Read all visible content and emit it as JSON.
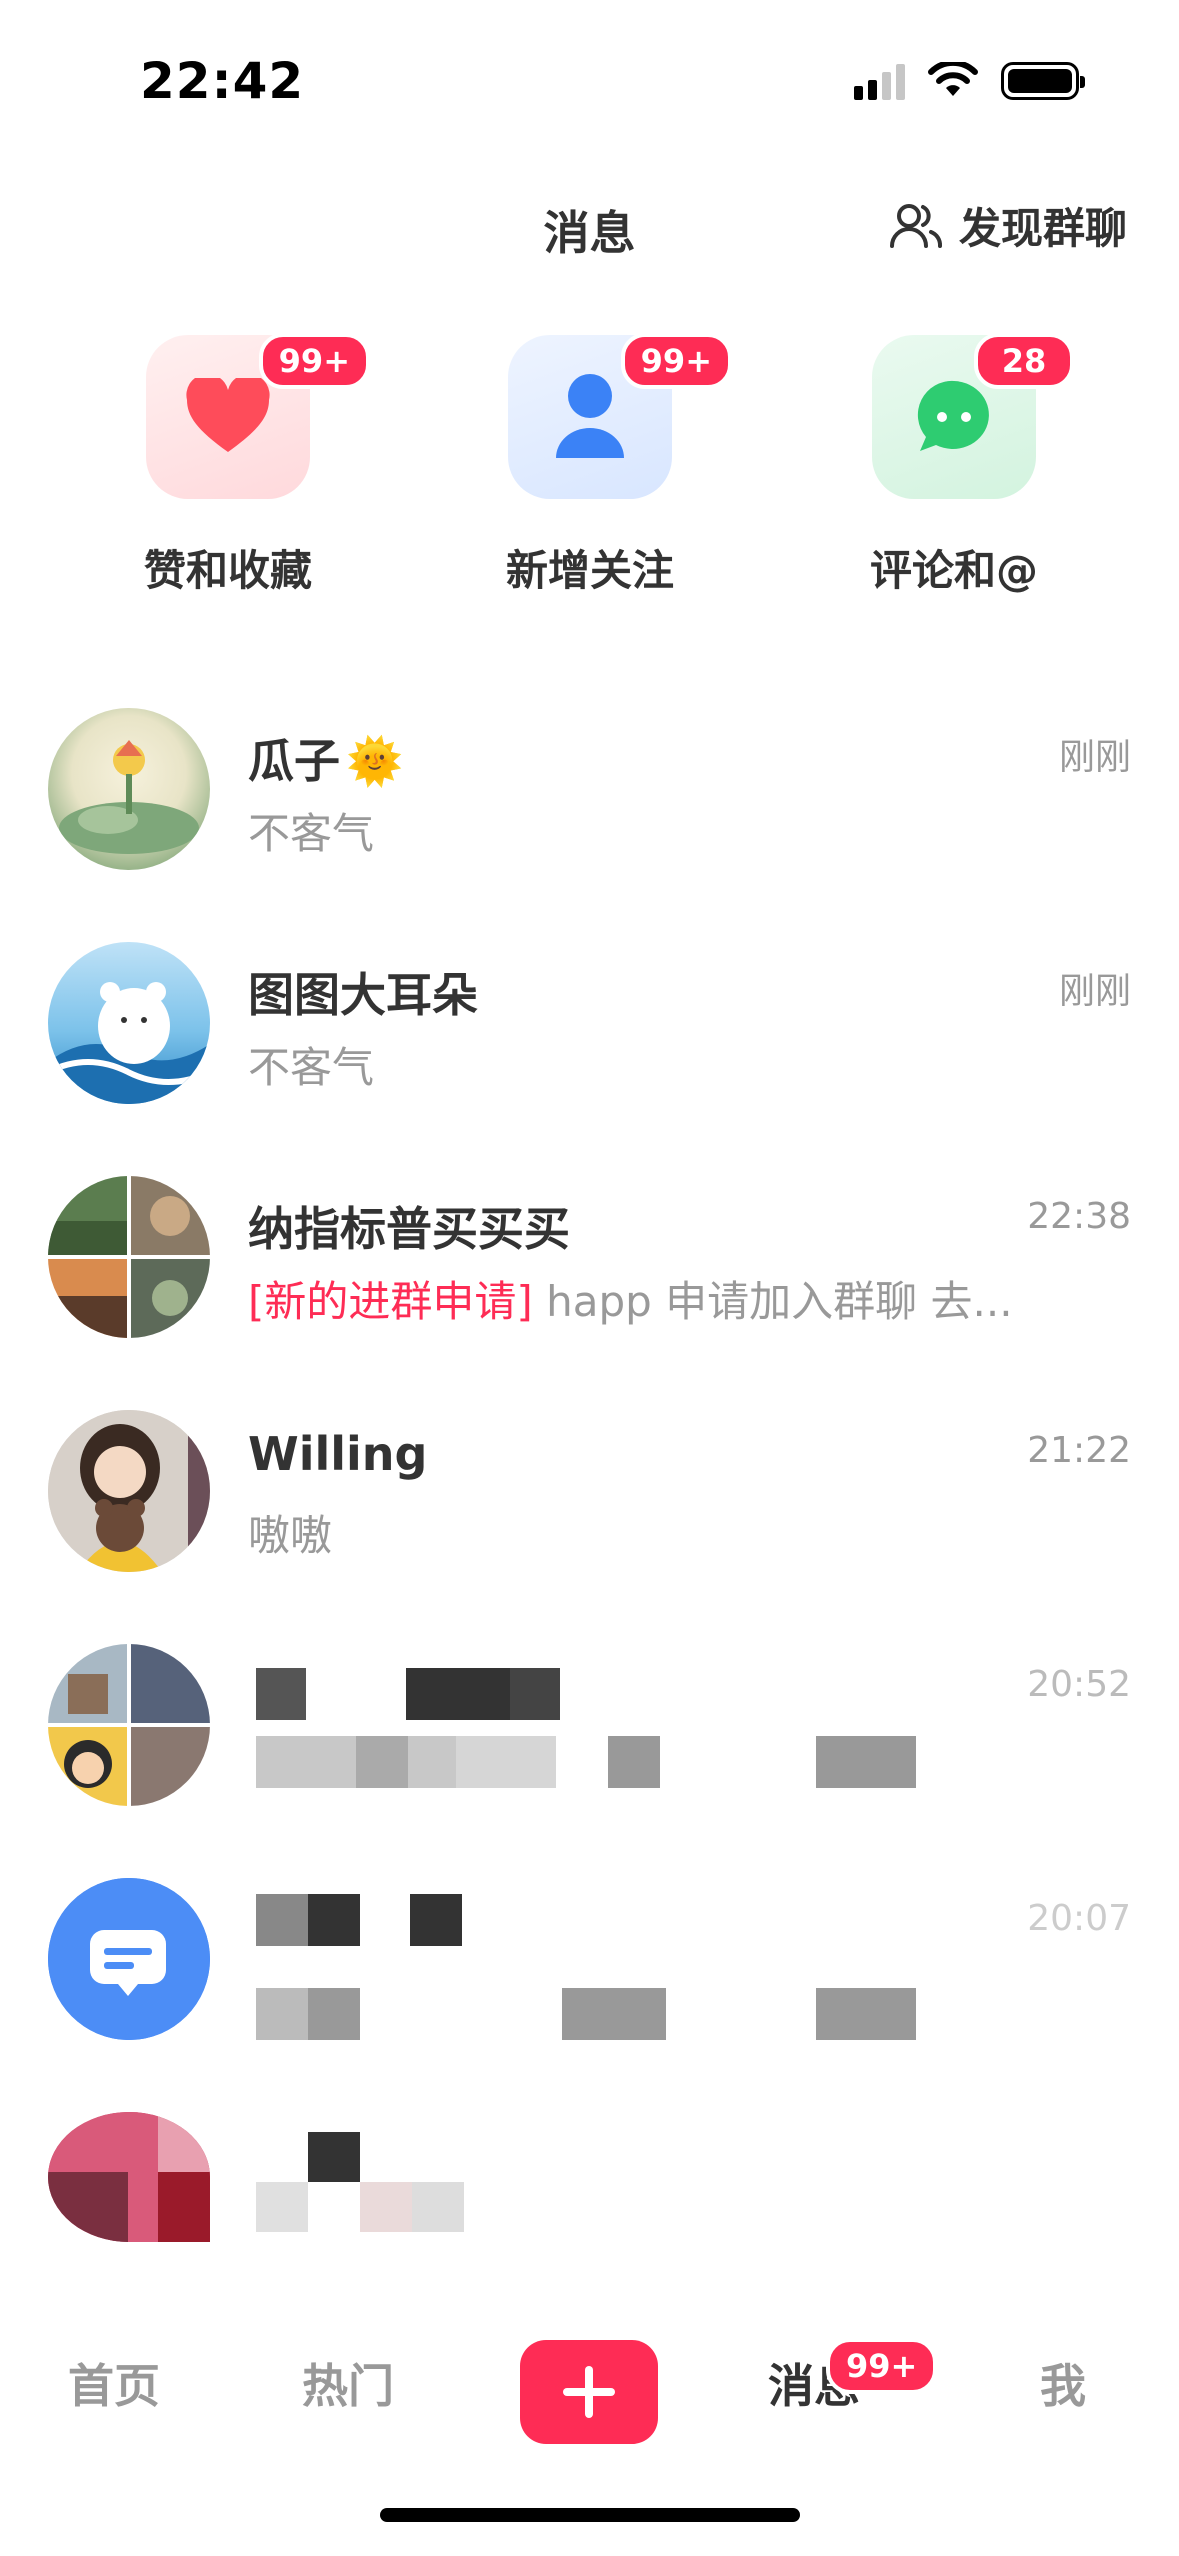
{
  "status_bar": {
    "time": "22:42"
  },
  "header": {
    "title": "消息",
    "discover_label": "发现群聊"
  },
  "shortcuts": [
    {
      "label": "赞和收藏",
      "badge": "99+",
      "icon": "heart-icon",
      "color": "#fe4c5a"
    },
    {
      "label": "新增关注",
      "badge": "99+",
      "icon": "person-icon",
      "color": "#3b82f6"
    },
    {
      "label": "评论和@",
      "badge": "28",
      "icon": "chat-bubble-icon",
      "color": "#2ecc71"
    }
  ],
  "chats": [
    {
      "name": "瓜子",
      "emoji": "🌞",
      "preview": "不客气",
      "time": "刚刚"
    },
    {
      "name": "图图大耳朵",
      "preview": "不客气",
      "time": "刚刚"
    },
    {
      "name": "纳指标普买买买",
      "preview_tag": "[新的进群申请]",
      "preview": " happ 申请加入群聊 去...",
      "time": "22:38"
    },
    {
      "name": "Willing",
      "preview": "嗷嗷",
      "time": "21:22"
    },
    {
      "time": "20:52"
    },
    {
      "time": "20:07"
    }
  ],
  "bottom_nav": {
    "items": [
      "首页",
      "热门",
      "消息",
      "我"
    ],
    "messages_badge": "99+"
  },
  "colors": {
    "accent": "#fe2c55"
  }
}
